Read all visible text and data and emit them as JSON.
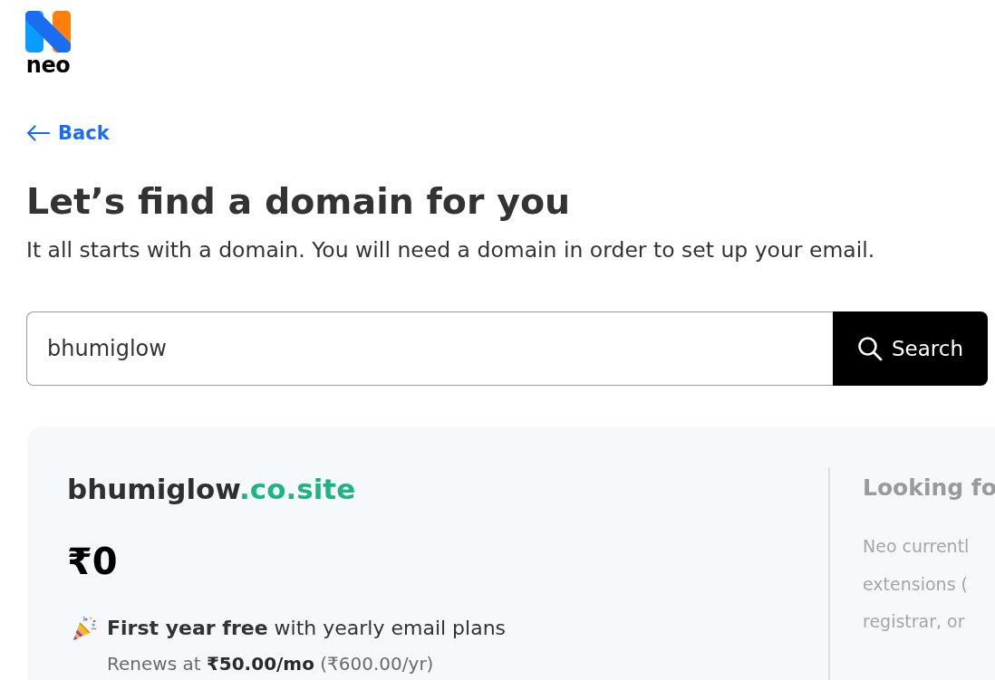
{
  "logo": {
    "text": "neo"
  },
  "back_link": {
    "label": "Back"
  },
  "heading": "Let’s find a domain for you",
  "subtitle": "It all starts with a domain. You will need a domain in order to set up your email.",
  "search": {
    "value": "bhumiglow",
    "button": "Search"
  },
  "result": {
    "domain": {
      "name": "bhumiglow",
      "extension": ".co.site"
    },
    "price": "₹0",
    "offer": "**First year free** with yearly email plans",
    "renewal": "Renews at **₹50.00/mo** (₹600.00/yr)"
  },
  "info": {
    "title": "Looking fo",
    "lines": [
      "Neo currentl",
      "extensions (",
      "registrar, or"
    ]
  }
}
